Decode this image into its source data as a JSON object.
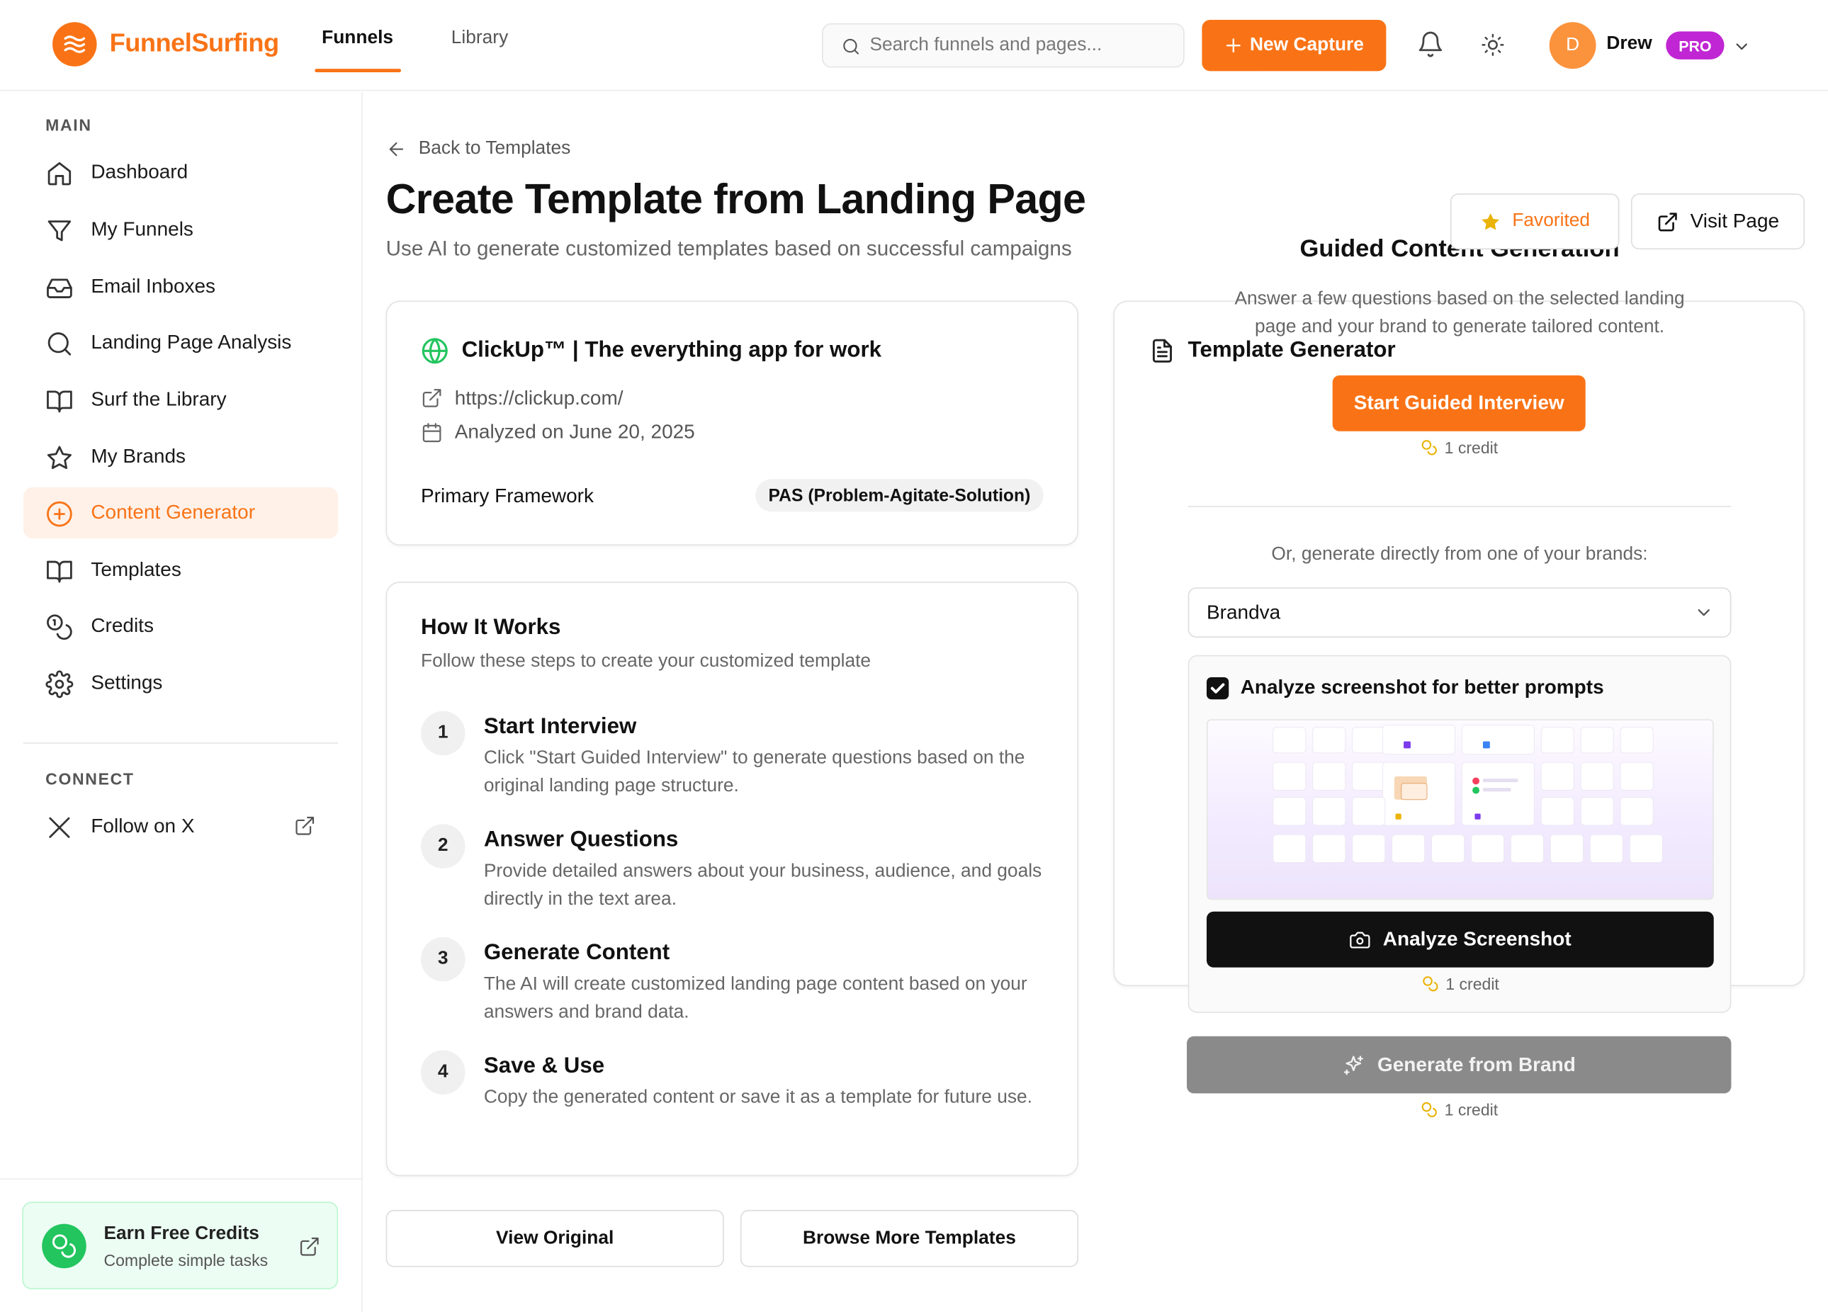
{
  "app": {
    "brand": "FunnelSurfing"
  },
  "header": {
    "tabs": [
      {
        "label": "Funnels"
      },
      {
        "label": "Library"
      }
    ],
    "search_placeholder": "Search funnels and pages...",
    "new_capture": "New Capture",
    "user_initial": "D",
    "user_name": "Drew",
    "badge": "PRO"
  },
  "sidebar": {
    "main_label": "MAIN",
    "items": [
      {
        "label": "Dashboard",
        "icon": "home-icon"
      },
      {
        "label": "My Funnels",
        "icon": "funnel-icon"
      },
      {
        "label": "Email Inboxes",
        "icon": "inbox-icon"
      },
      {
        "label": "Landing Page Analysis",
        "icon": "search-icon"
      },
      {
        "label": "Surf the Library",
        "icon": "book-icon"
      },
      {
        "label": "My Brands",
        "icon": "star-icon"
      },
      {
        "label": "Content Generator",
        "icon": "plus-circle-icon",
        "active": true
      },
      {
        "label": "Templates",
        "icon": "book-icon"
      },
      {
        "label": "Credits",
        "icon": "coins-icon"
      },
      {
        "label": "Settings",
        "icon": "gear-icon"
      }
    ],
    "connect_label": "CONNECT",
    "follow": "Follow on X",
    "earn_title": "Earn Free Credits",
    "earn_sub": "Complete simple tasks"
  },
  "main": {
    "back": "Back to Templates",
    "title": "Create Template from Landing Page",
    "subtitle": "Use AI to generate customized templates based on successful campaigns",
    "favorited": "Favorited",
    "visit": "Visit Page",
    "page_card": {
      "title": "ClickUp™ | The everything app for work",
      "url": "https://clickup.com/",
      "analyzed": "Analyzed on June 20, 2025",
      "framework_label": "Primary Framework",
      "framework_value": "PAS (Problem-Agitate-Solution)"
    },
    "how": {
      "title": "How It Works",
      "subtitle": "Follow these steps to create your customized template",
      "steps": [
        {
          "num": "1",
          "title": "Start Interview",
          "desc": "Click \"Start Guided Interview\" to generate questions based on the original landing page structure."
        },
        {
          "num": "2",
          "title": "Answer Questions",
          "desc": "Provide detailed answers about your business, audience, and goals directly in the text area."
        },
        {
          "num": "3",
          "title": "Generate Content",
          "desc": "The AI will create customized landing page content based on your answers and brand data."
        },
        {
          "num": "4",
          "title": "Save & Use",
          "desc": "Copy the generated content or save it as a template for future use."
        }
      ]
    },
    "view_original": "View Original",
    "browse_more": "Browse More Templates",
    "generator": {
      "title": "Template Generator",
      "guided_title": "Guided Content Generation",
      "guided_desc_1": "Answer a few questions based on the selected landing",
      "guided_desc_2": "page and your brand to generate tailored content.",
      "start_btn": "Start Guided Interview",
      "credit": "1 credit",
      "or_text": "Or, generate directly from one of your brands:",
      "brand_selected": "Brandva",
      "analyze_checkbox": "Analyze screenshot for better prompts",
      "analyze_btn": "Analyze Screenshot",
      "generate_btn": "Generate from Brand"
    }
  },
  "colors": {
    "accent": "#f97316",
    "pro": "#c026d3",
    "success": "#22c55e"
  }
}
